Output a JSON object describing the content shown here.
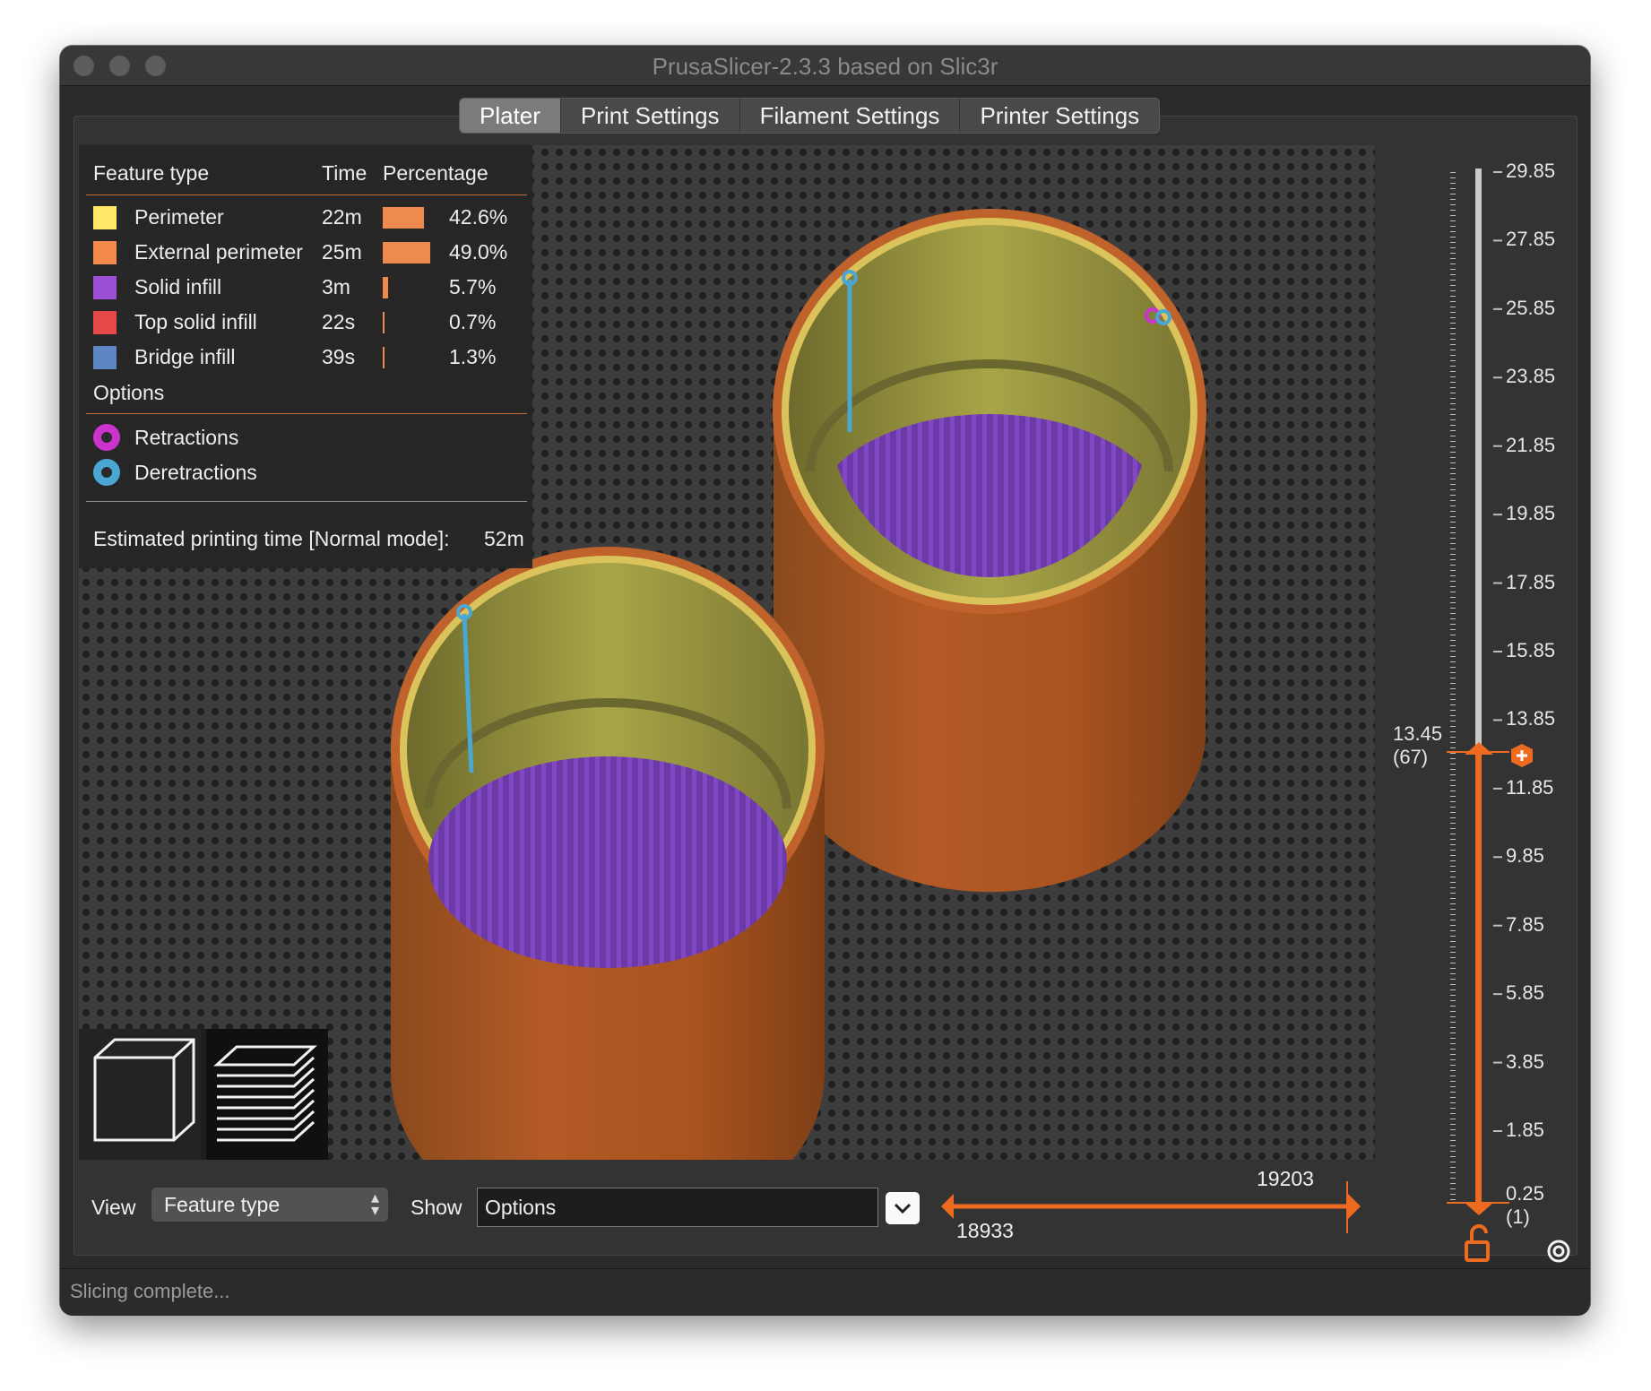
{
  "window": {
    "title": "PrusaSlicer-2.3.3 based on Slic3r",
    "status": "Slicing complete..."
  },
  "tabs": [
    {
      "label": "Plater",
      "active": true
    },
    {
      "label": "Print Settings",
      "active": false
    },
    {
      "label": "Filament Settings",
      "active": false
    },
    {
      "label": "Printer Settings",
      "active": false
    }
  ],
  "legend": {
    "headers": {
      "feature_type": "Feature type",
      "time": "Time",
      "percentage": "Percentage"
    },
    "rows": [
      {
        "name": "Perimeter",
        "time": "22m",
        "percentage": "42.6%",
        "fraction": 0.426,
        "color": "#ffe666"
      },
      {
        "name": "External perimeter",
        "time": "25m",
        "percentage": "49.0%",
        "fraction": 0.49,
        "color": "#f5894a"
      },
      {
        "name": "Solid infill",
        "time": "3m",
        "percentage": "5.7%",
        "fraction": 0.057,
        "color": "#9c4fd6"
      },
      {
        "name": "Top solid infill",
        "time": "22s",
        "percentage": "0.7%",
        "fraction": 0.007,
        "color": "#e54848"
      },
      {
        "name": "Bridge infill",
        "time": "39s",
        "percentage": "1.3%",
        "fraction": 0.013,
        "color": "#5d85c4"
      }
    ],
    "options_title": "Options",
    "options": [
      {
        "name": "Retractions",
        "color": "#cc33cc"
      },
      {
        "name": "Deretractions",
        "color": "#4aa7d4"
      }
    ],
    "estimated_label": "Estimated printing time [Normal mode]:",
    "estimated_value": "52m"
  },
  "bottom_bar": {
    "view_label": "View",
    "view_value": "Feature type",
    "show_label": "Show",
    "show_value": "Options",
    "h_slider": {
      "low": "18933",
      "high": "19203"
    }
  },
  "layer_slider": {
    "ticks": [
      "29.85",
      "27.85",
      "25.85",
      "23.85",
      "21.85",
      "19.85",
      "17.85",
      "15.85",
      "13.85",
      "11.85",
      "9.85",
      "7.85",
      "5.85",
      "3.85",
      "1.85"
    ],
    "upper_value": "13.45",
    "upper_layer": "(67)",
    "lower_value": "0.25",
    "lower_layer": "(1)"
  },
  "colors": {
    "accent": "#ed6b21",
    "perimeter_wall": "#a6a43f",
    "external_perimeter": "#b5582a",
    "solid_infill": "#7440b0"
  }
}
